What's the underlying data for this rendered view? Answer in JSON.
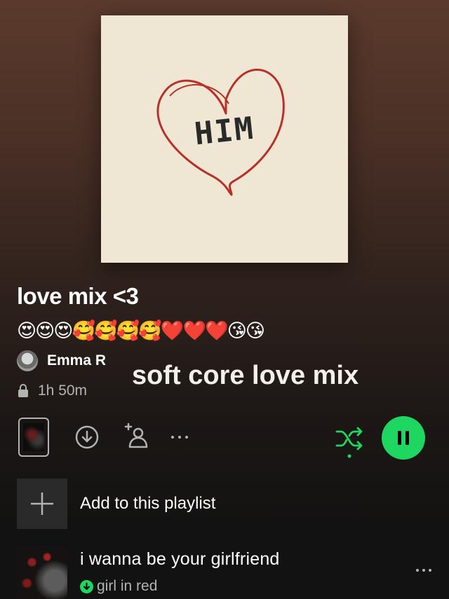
{
  "playlist": {
    "cover_text": "HIM",
    "title": "love mix <3",
    "description_emojis": "😍😍😍🥰🥰🥰🥰❤️❤️❤️😘😘",
    "owner_name": "Emma R",
    "duration": "1h 50m"
  },
  "overlay_caption": "soft core love mix",
  "actions": {
    "add_to_playlist_label": "Add to this playlist"
  },
  "tracks": [
    {
      "title": "i wanna be your girlfriend",
      "artist": "girl in red",
      "downloaded": true
    }
  ],
  "colors": {
    "accent_green": "#1ed760",
    "text_secondary": "#b3b3b3",
    "background": "#121212"
  },
  "icons": {
    "download": "download-icon",
    "add_collaborator": "add-user-icon",
    "more": "more-icon",
    "shuffle": "shuffle-icon",
    "pause": "pause-icon",
    "lock": "lock-icon",
    "plus": "plus-icon"
  }
}
